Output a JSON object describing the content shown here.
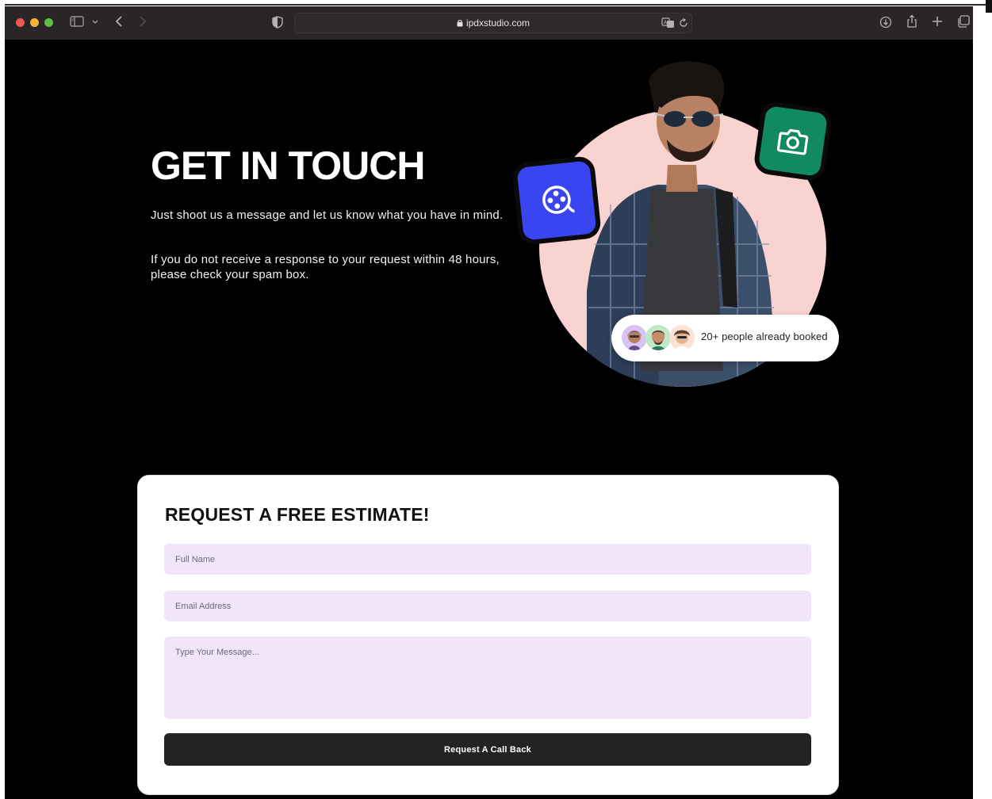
{
  "browser": {
    "url": "ipdxstudio.com"
  },
  "hero": {
    "title": "GET IN TOUCH",
    "paragraph_1": "Just shoot us a message and let us know what you have in mind.",
    "paragraph_2": "If you do not receive a response to your request within 48 hours, please check your spam box."
  },
  "illustration": {
    "booked_text": "20+ people already booked",
    "film_icon": "film-reel-icon",
    "camera_icon": "camera-icon"
  },
  "form": {
    "title": "REQUEST A FREE ESTIMATE!",
    "full_name_placeholder": "Full Name",
    "email_placeholder": "Email Address",
    "message_placeholder": "Type Your Message...",
    "submit_label": "Request A Call Back"
  },
  "colors": {
    "page_bg": "#000000",
    "circle_bg": "#f9d3cf",
    "film_tile": "#3945f0",
    "camera_tile": "#108a5e",
    "field_bg": "#f1e5f9",
    "button_bg": "#232323"
  }
}
